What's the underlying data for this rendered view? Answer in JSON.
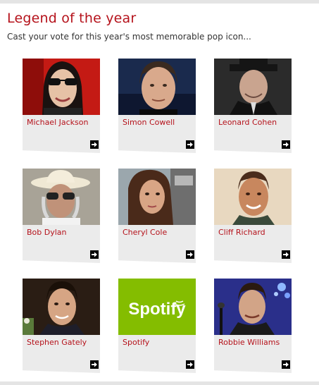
{
  "header": {
    "title": "Legend of the year",
    "subtitle": "Cast your vote for this year's most memorable pop icon..."
  },
  "candidates": [
    {
      "name": "Michael Jackson",
      "icon": "arrow-right-icon"
    },
    {
      "name": "Simon Cowell",
      "icon": "arrow-right-icon"
    },
    {
      "name": "Leonard Cohen",
      "icon": "arrow-right-icon"
    },
    {
      "name": "Bob Dylan",
      "icon": "arrow-right-icon"
    },
    {
      "name": "Cheryl Cole",
      "icon": "arrow-right-icon"
    },
    {
      "name": "Cliff Richard",
      "icon": "arrow-right-icon"
    },
    {
      "name": "Stephen Gately",
      "icon": "arrow-right-icon"
    },
    {
      "name": "Spotify",
      "icon": "arrow-right-icon"
    },
    {
      "name": "Robbie Williams",
      "icon": "arrow-right-icon"
    }
  ],
  "spotify_logo_text": "Spotify",
  "colors": {
    "accent": "#b5121b",
    "card_footer": "#ebebeb",
    "spotify_green": "#84bd00"
  }
}
